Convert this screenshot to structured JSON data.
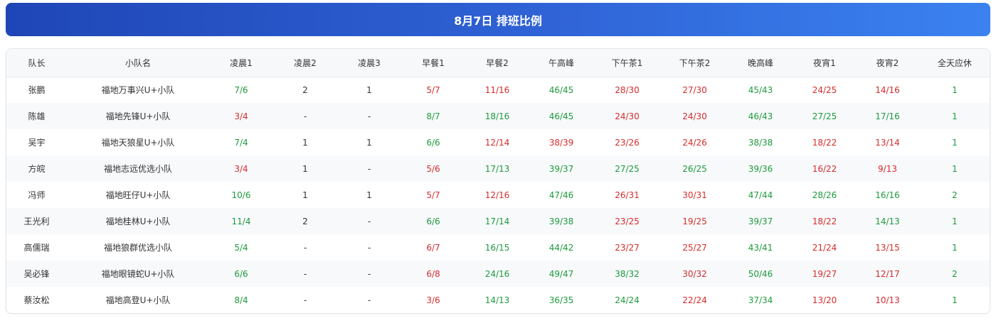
{
  "title": "8月7日 排班比例",
  "colors": {
    "green": "#1d9a3c",
    "red": "#d62b2b",
    "header_start": "#1f46b6",
    "header_end": "#3b82f0"
  },
  "columns": [
    "队长",
    "小队名",
    "凌晨1",
    "凌晨2",
    "凌晨3",
    "早餐1",
    "早餐2",
    "午高峰",
    "下午茶1",
    "下午茶2",
    "晚高峰",
    "夜宵1",
    "夜宵2",
    "全天应休"
  ],
  "rows": [
    {
      "cells": [
        {
          "v": "张鹏",
          "c": "plain"
        },
        {
          "v": "福地万事兴U+小队",
          "c": "plain"
        },
        {
          "v": "7/6",
          "c": "green"
        },
        {
          "v": "2",
          "c": "plain"
        },
        {
          "v": "1",
          "c": "plain"
        },
        {
          "v": "5/7",
          "c": "red"
        },
        {
          "v": "11/16",
          "c": "red"
        },
        {
          "v": "46/45",
          "c": "green"
        },
        {
          "v": "28/30",
          "c": "red"
        },
        {
          "v": "27/30",
          "c": "red"
        },
        {
          "v": "45/43",
          "c": "green"
        },
        {
          "v": "24/25",
          "c": "red"
        },
        {
          "v": "14/16",
          "c": "red"
        },
        {
          "v": "1",
          "c": "green"
        }
      ]
    },
    {
      "cells": [
        {
          "v": "陈雄",
          "c": "plain"
        },
        {
          "v": "福地先锋U+小队",
          "c": "plain"
        },
        {
          "v": "3/4",
          "c": "red"
        },
        {
          "v": "-",
          "c": "plain"
        },
        {
          "v": "-",
          "c": "plain"
        },
        {
          "v": "8/7",
          "c": "green"
        },
        {
          "v": "18/16",
          "c": "green"
        },
        {
          "v": "46/45",
          "c": "green"
        },
        {
          "v": "24/30",
          "c": "red"
        },
        {
          "v": "24/30",
          "c": "red"
        },
        {
          "v": "46/43",
          "c": "green"
        },
        {
          "v": "27/25",
          "c": "green"
        },
        {
          "v": "17/16",
          "c": "green"
        },
        {
          "v": "1",
          "c": "green"
        }
      ]
    },
    {
      "cells": [
        {
          "v": "吴宇",
          "c": "plain"
        },
        {
          "v": "福地天狼星U+小队",
          "c": "plain"
        },
        {
          "v": "7/4",
          "c": "green"
        },
        {
          "v": "1",
          "c": "plain"
        },
        {
          "v": "1",
          "c": "plain"
        },
        {
          "v": "6/6",
          "c": "green"
        },
        {
          "v": "12/14",
          "c": "red"
        },
        {
          "v": "38/39",
          "c": "red"
        },
        {
          "v": "23/26",
          "c": "red"
        },
        {
          "v": "24/26",
          "c": "red"
        },
        {
          "v": "38/38",
          "c": "green"
        },
        {
          "v": "18/22",
          "c": "red"
        },
        {
          "v": "13/14",
          "c": "red"
        },
        {
          "v": "1",
          "c": "green"
        }
      ]
    },
    {
      "cells": [
        {
          "v": "方皖",
          "c": "plain"
        },
        {
          "v": "福地志远优选小队",
          "c": "plain"
        },
        {
          "v": "3/4",
          "c": "red"
        },
        {
          "v": "1",
          "c": "plain"
        },
        {
          "v": "-",
          "c": "plain"
        },
        {
          "v": "5/6",
          "c": "red"
        },
        {
          "v": "17/13",
          "c": "green"
        },
        {
          "v": "39/37",
          "c": "green"
        },
        {
          "v": "27/25",
          "c": "green"
        },
        {
          "v": "26/25",
          "c": "green"
        },
        {
          "v": "39/36",
          "c": "green"
        },
        {
          "v": "16/22",
          "c": "red"
        },
        {
          "v": "9/13",
          "c": "red"
        },
        {
          "v": "1",
          "c": "green"
        }
      ]
    },
    {
      "cells": [
        {
          "v": "冯师",
          "c": "plain"
        },
        {
          "v": "福地旺仔U+小队",
          "c": "plain"
        },
        {
          "v": "10/6",
          "c": "green"
        },
        {
          "v": "1",
          "c": "plain"
        },
        {
          "v": "1",
          "c": "plain"
        },
        {
          "v": "5/7",
          "c": "red"
        },
        {
          "v": "12/16",
          "c": "red"
        },
        {
          "v": "47/46",
          "c": "green"
        },
        {
          "v": "26/31",
          "c": "red"
        },
        {
          "v": "30/31",
          "c": "red"
        },
        {
          "v": "47/44",
          "c": "green"
        },
        {
          "v": "28/26",
          "c": "green"
        },
        {
          "v": "16/16",
          "c": "green"
        },
        {
          "v": "2",
          "c": "green"
        }
      ]
    },
    {
      "cells": [
        {
          "v": "王光利",
          "c": "plain"
        },
        {
          "v": "福地桂林U+小队",
          "c": "plain"
        },
        {
          "v": "11/4",
          "c": "green"
        },
        {
          "v": "2",
          "c": "plain"
        },
        {
          "v": "-",
          "c": "plain"
        },
        {
          "v": "6/6",
          "c": "green"
        },
        {
          "v": "17/14",
          "c": "green"
        },
        {
          "v": "39/38",
          "c": "green"
        },
        {
          "v": "23/25",
          "c": "red"
        },
        {
          "v": "19/25",
          "c": "red"
        },
        {
          "v": "39/37",
          "c": "green"
        },
        {
          "v": "18/22",
          "c": "red"
        },
        {
          "v": "14/13",
          "c": "green"
        },
        {
          "v": "1",
          "c": "green"
        }
      ]
    },
    {
      "cells": [
        {
          "v": "高儒瑞",
          "c": "plain"
        },
        {
          "v": "福地狼群优选小队",
          "c": "plain"
        },
        {
          "v": "5/4",
          "c": "green"
        },
        {
          "v": "-",
          "c": "plain"
        },
        {
          "v": "-",
          "c": "plain"
        },
        {
          "v": "6/7",
          "c": "red"
        },
        {
          "v": "16/15",
          "c": "green"
        },
        {
          "v": "44/42",
          "c": "green"
        },
        {
          "v": "23/27",
          "c": "red"
        },
        {
          "v": "25/27",
          "c": "red"
        },
        {
          "v": "43/41",
          "c": "green"
        },
        {
          "v": "21/24",
          "c": "red"
        },
        {
          "v": "13/15",
          "c": "red"
        },
        {
          "v": "1",
          "c": "green"
        }
      ]
    },
    {
      "cells": [
        {
          "v": "吴必锋",
          "c": "plain"
        },
        {
          "v": "福地眼镜蛇U+小队",
          "c": "plain"
        },
        {
          "v": "6/6",
          "c": "green"
        },
        {
          "v": "-",
          "c": "plain"
        },
        {
          "v": "-",
          "c": "plain"
        },
        {
          "v": "6/8",
          "c": "red"
        },
        {
          "v": "24/16",
          "c": "green"
        },
        {
          "v": "49/47",
          "c": "green"
        },
        {
          "v": "38/32",
          "c": "green"
        },
        {
          "v": "30/32",
          "c": "red"
        },
        {
          "v": "50/46",
          "c": "green"
        },
        {
          "v": "19/27",
          "c": "red"
        },
        {
          "v": "12/17",
          "c": "red"
        },
        {
          "v": "2",
          "c": "green"
        }
      ]
    },
    {
      "cells": [
        {
          "v": "蔡汝松",
          "c": "plain"
        },
        {
          "v": "福地高登U+小队",
          "c": "plain"
        },
        {
          "v": "8/4",
          "c": "green"
        },
        {
          "v": "-",
          "c": "plain"
        },
        {
          "v": "-",
          "c": "plain"
        },
        {
          "v": "3/6",
          "c": "red"
        },
        {
          "v": "14/13",
          "c": "green"
        },
        {
          "v": "36/35",
          "c": "green"
        },
        {
          "v": "24/24",
          "c": "green"
        },
        {
          "v": "22/24",
          "c": "red"
        },
        {
          "v": "37/34",
          "c": "green"
        },
        {
          "v": "13/20",
          "c": "red"
        },
        {
          "v": "10/13",
          "c": "red"
        },
        {
          "v": "1",
          "c": "green"
        }
      ]
    }
  ]
}
